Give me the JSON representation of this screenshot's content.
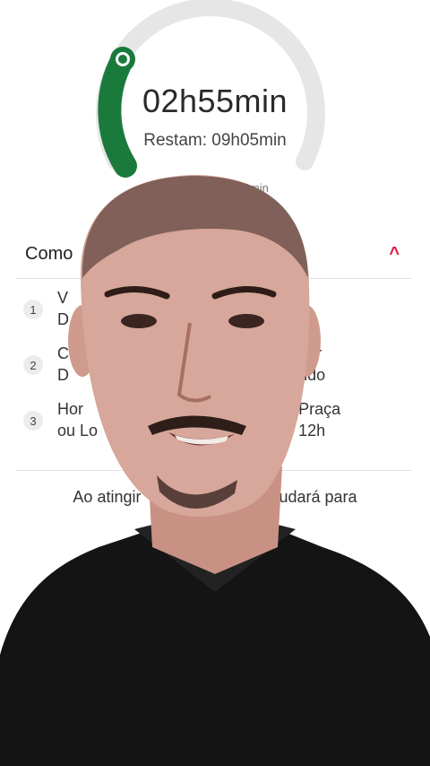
{
  "timer": {
    "elapsed": "02h55min",
    "remaining": "Restam: 09h05min",
    "total_partial": "6h43min",
    "progress": 0.24,
    "colors": {
      "progress": "#1a7a3c",
      "track": "#e6e6e6"
    }
  },
  "section": {
    "title": "Como",
    "collapse_icon": "chevron-up-icon",
    "accent": "#e5173f"
  },
  "steps": [
    {
      "number": "1",
      "line1": "V                                            ar",
      "line2": "D"
    },
    {
      "number": "2",
      "line1": "C                                       ocê estiver",
      "line2": "D                                        guardando"
    },
    {
      "number": "3",
      "line1": "Hor                                     regas, Praça",
      "line2": "ou Lo                                mite de 12h"
    }
  ],
  "footer": {
    "text": "Ao atingir                         s mudará para"
  },
  "overlay": {
    "type": "webcam-person",
    "shirt_color": "#141414",
    "skin_color": "#d6a79a"
  }
}
